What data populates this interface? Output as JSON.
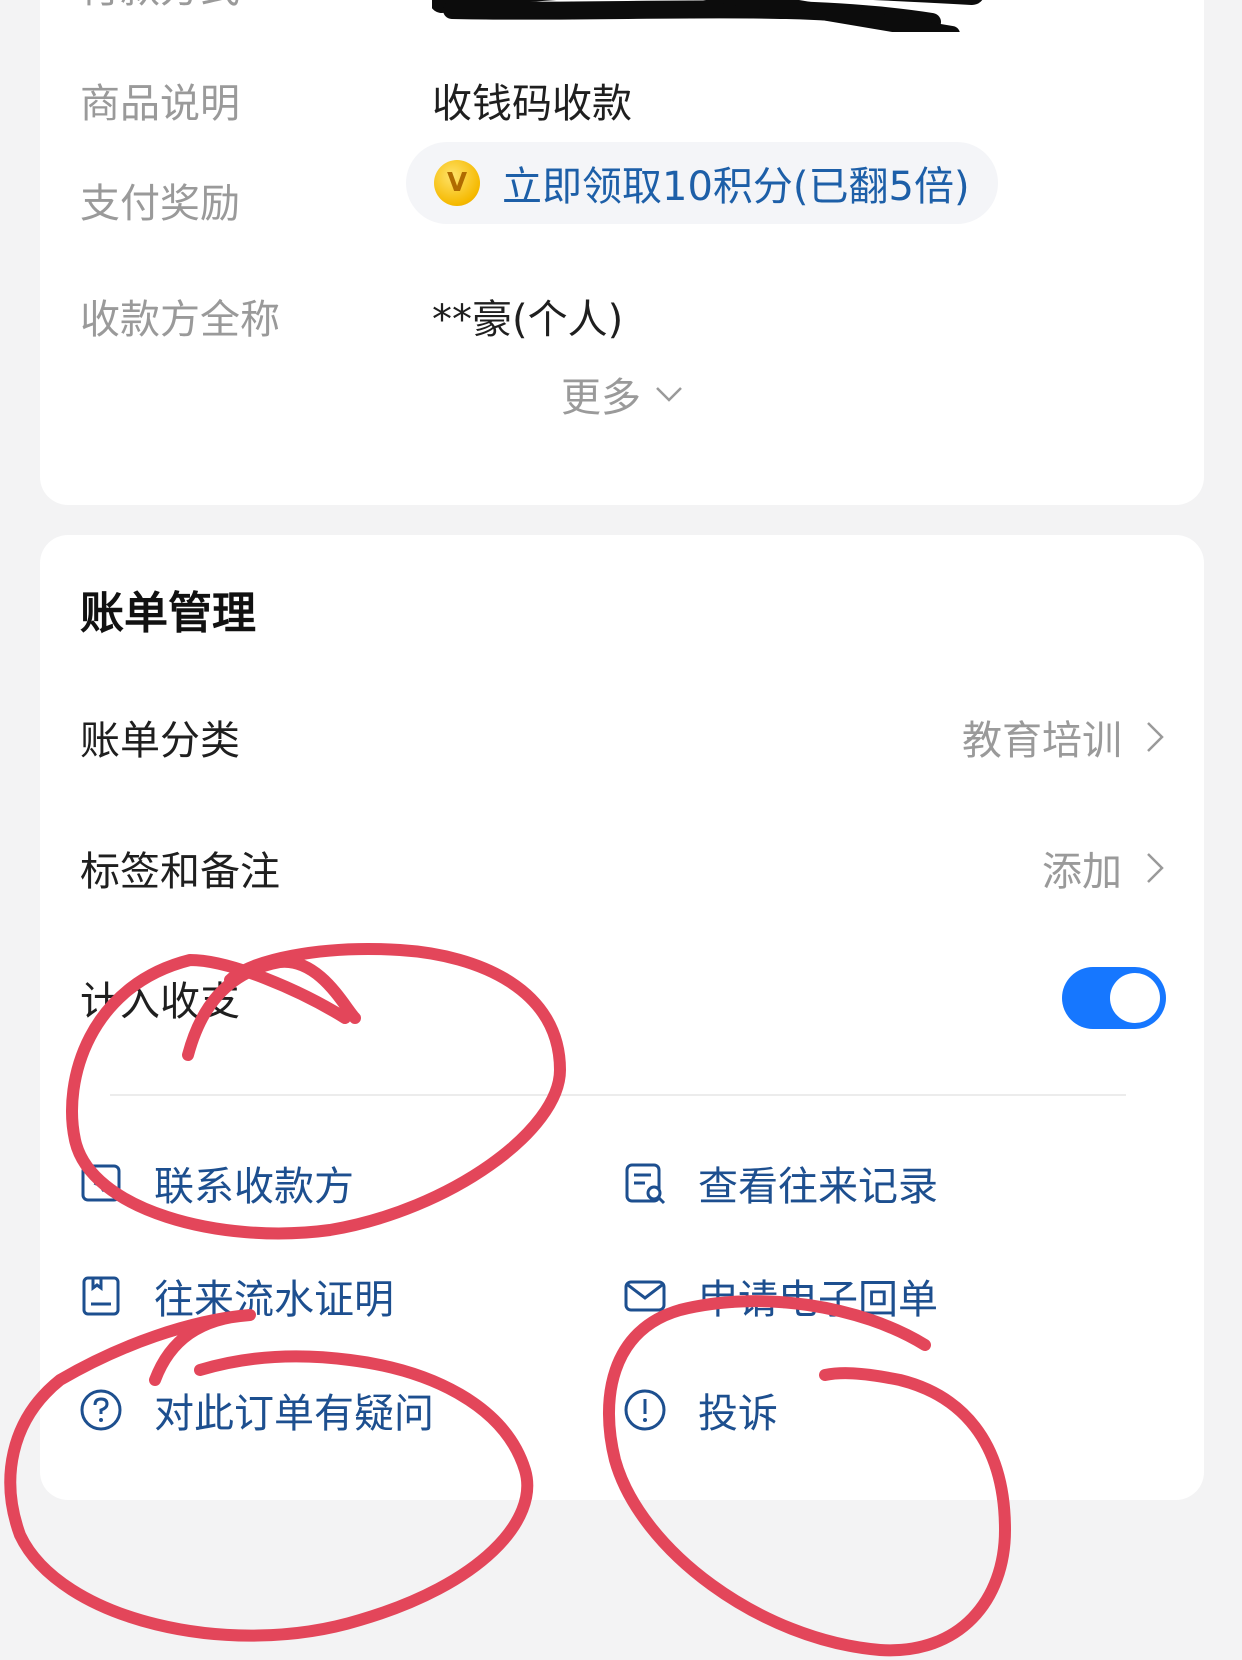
{
  "details": {
    "payment_method_label": "付款方式",
    "product_desc_label": "商品说明",
    "product_desc_value": "收钱码收款",
    "reward_label": "支付奖励",
    "reward_text": "立即领取10积分(已翻5倍)",
    "payee_label": "收款方全称",
    "payee_value": "**豪(个人)",
    "more_label": "更多"
  },
  "bill_management": {
    "title": "账单管理",
    "category_label": "账单分类",
    "category_value": "教育培训",
    "tags_label": "标签和备注",
    "tags_value": "添加",
    "include_label": "计入收支",
    "include_enabled": true
  },
  "actions": {
    "contact_payee": "联系收款方",
    "view_records": "查看往来记录",
    "transaction_proof": "往来流水证明",
    "e_receipt": "申请电子回单",
    "order_question": "对此订单有疑问",
    "complain": "投诉"
  },
  "colors": {
    "accent_blue": "#1677ff",
    "link_blue": "#1d4f8f",
    "annotation_red": "#e3465a"
  }
}
